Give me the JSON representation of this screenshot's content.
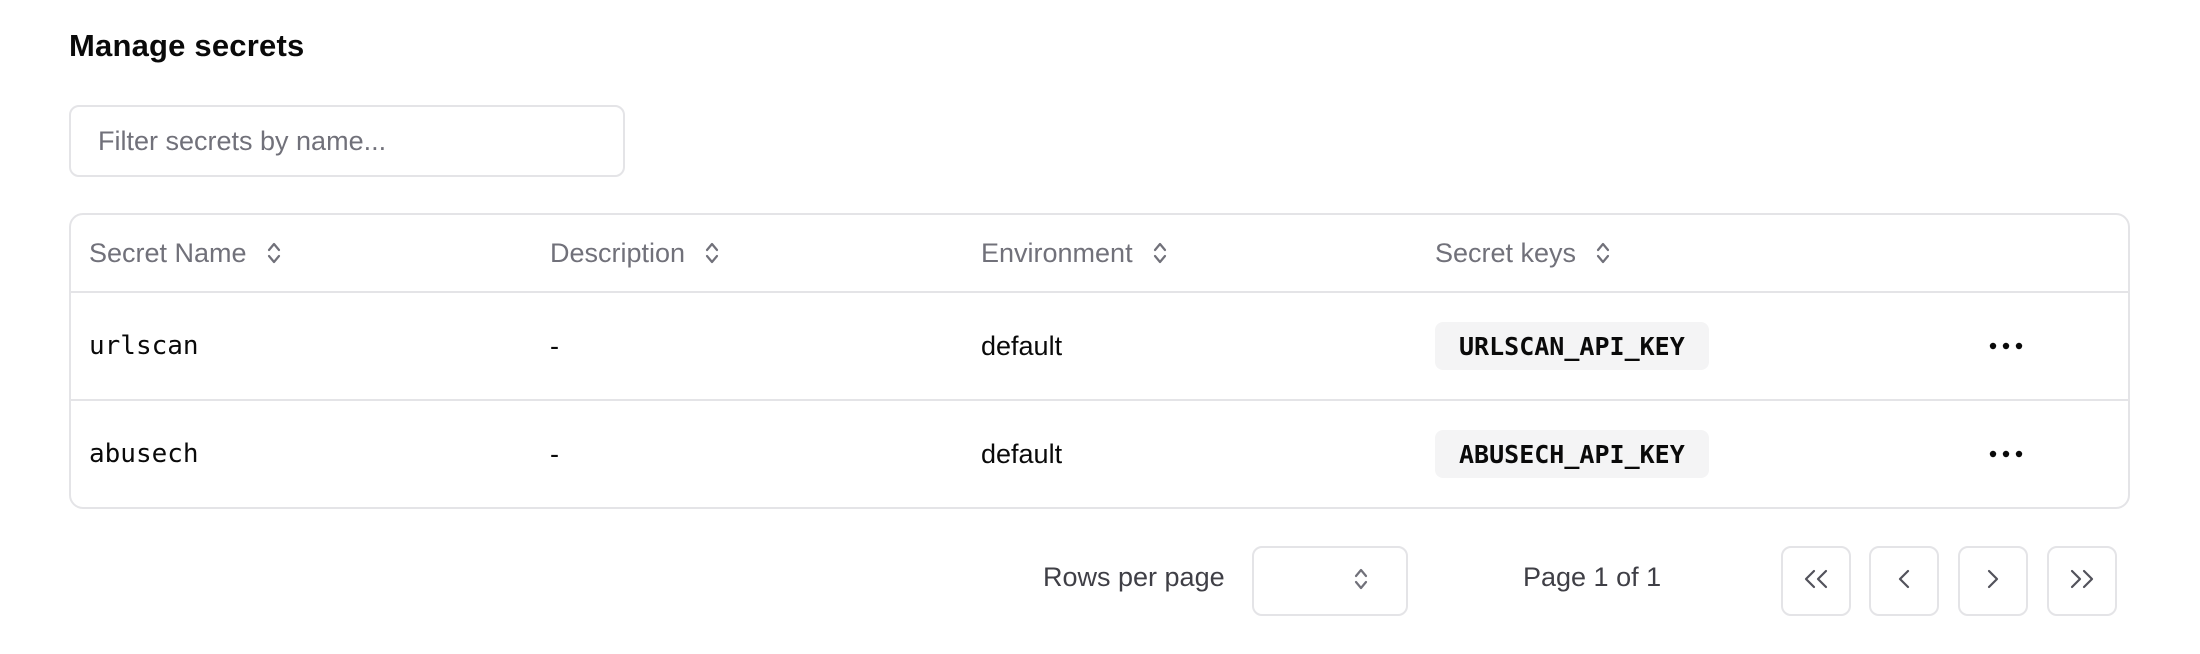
{
  "page": {
    "title": "Manage secrets"
  },
  "filter": {
    "placeholder": "Filter secrets by name...",
    "value": ""
  },
  "table": {
    "columns": [
      {
        "label": "Secret Name"
      },
      {
        "label": "Description"
      },
      {
        "label": "Environment"
      },
      {
        "label": "Secret keys"
      }
    ],
    "rows": [
      {
        "name": "urlscan",
        "description": "-",
        "environment": "default",
        "keys": [
          "URLSCAN_API_KEY"
        ]
      },
      {
        "name": "abusech",
        "description": "-",
        "environment": "default",
        "keys": [
          "ABUSECH_API_KEY"
        ]
      }
    ]
  },
  "pagination": {
    "rows_per_page_label": "Rows per page",
    "rows_per_page_value": "",
    "page_label": "Page 1 of 1"
  },
  "icons": {
    "sort": "chevron-up-down-icon",
    "row_actions": "more-horizontal-icon",
    "first_page": "chevrons-left-icon",
    "previous_page": "chevron-left-icon",
    "next_page": "chevron-right-icon",
    "last_page": "chevrons-right-icon"
  },
  "colors": {
    "border": "#e4e4e7",
    "muted_text": "#71717a",
    "badge_background": "#f4f4f5"
  }
}
